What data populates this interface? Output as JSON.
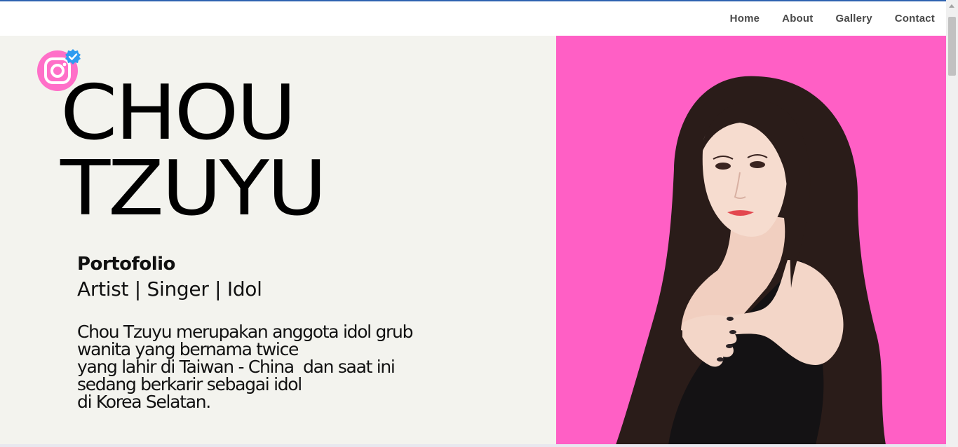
{
  "nav": {
    "links": [
      "Home",
      "About",
      "Gallery",
      "Contact"
    ]
  },
  "hero": {
    "name_line1": "CHOU",
    "name_line2": "TZUYU",
    "portfolio_title": "Portofolio",
    "roles": "Artist | Singer | Idol",
    "bio_lines": [
      "Chou Tzuyu merupakan anggota idol grub",
      "wanita yang bernama twice",
      "yang lahir di Taiwan - China  dan saat ini",
      "sedang berkarir sebagai idol",
      "di Korea Selatan."
    ],
    "photo_alt": "Chou Tzuyu portrait"
  },
  "icons": {
    "social": "instagram-icon",
    "badge": "verified-badge-icon"
  },
  "colors": {
    "accent_pink": "#ff5fc5",
    "instagram_pink": "#ff6fc8",
    "verified_blue": "#2f9bf0",
    "left_bg": "#f3f3ee"
  }
}
